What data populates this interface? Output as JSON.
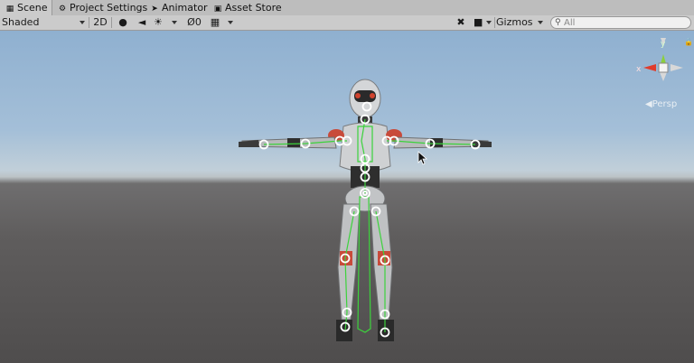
{
  "tabs": [
    {
      "label": "Scene",
      "icon": "scene-icon"
    },
    {
      "label": "Project Settings",
      "icon": "gear-icon"
    },
    {
      "label": "Animator",
      "icon": "animator-icon"
    },
    {
      "label": "Asset Store",
      "icon": "bag-icon"
    }
  ],
  "toolbar": {
    "shading_mode": "Shaded",
    "mode_2d": "2D",
    "hidden_count": "0",
    "gizmos": "Gizmos",
    "search_placeholder": "All"
  },
  "viewport": {
    "projection_label": "Persp",
    "axis_y": "y",
    "axis_x": "x",
    "colors": {
      "x_axis": "#e03c2c",
      "y_axis": "#8ccf3c",
      "bone": "#3cd23c"
    }
  }
}
